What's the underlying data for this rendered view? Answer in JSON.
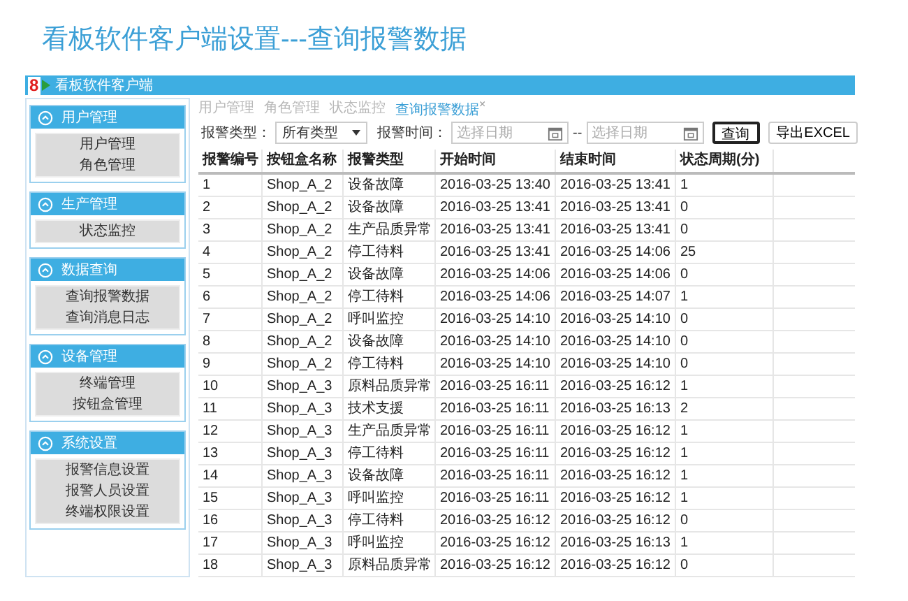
{
  "page_title": "看板软件客户端设置---查询报警数据",
  "window": {
    "title": "看板软件客户端",
    "logo_text": "8"
  },
  "sidebar": {
    "groups": [
      {
        "label": "用户管理",
        "expanded": true,
        "items": [
          "用户管理",
          "角色管理"
        ]
      },
      {
        "label": "生产管理",
        "expanded": true,
        "items": [
          "状态监控"
        ]
      },
      {
        "label": "数据查询",
        "expanded": true,
        "items": [
          "查询报警数据",
          "查询消息日志"
        ]
      },
      {
        "label": "设备管理",
        "expanded": true,
        "items": [
          "终端管理",
          "按钮盒管理"
        ]
      },
      {
        "label": "系统设置",
        "expanded": true,
        "items": [
          "报警信息设置",
          "报警人员设置",
          "终端权限设置"
        ]
      }
    ]
  },
  "tabs": [
    {
      "label": "用户管理",
      "selected": false
    },
    {
      "label": "角色管理",
      "selected": false
    },
    {
      "label": "状态监控",
      "selected": false
    },
    {
      "label": "查询报警数据",
      "selected": true,
      "close": "×"
    }
  ],
  "filters": {
    "type_label": "报警类型：",
    "type_value": "所有类型",
    "time_label": "报警时间：",
    "start": {
      "placeholder": "选择日期"
    },
    "separator": "--",
    "end": {
      "placeholder": "选择日期"
    },
    "buttons": [
      {
        "label": "查询",
        "focused": true
      },
      {
        "label": "导出EXCEL",
        "focused": false
      }
    ]
  },
  "table": {
    "columns": [
      "报警编号",
      "按钮盒名称",
      "报警类型",
      "开始时间",
      "结束时间",
      "状态周期(分)"
    ],
    "rows": [
      [
        "1",
        "Shop_A_2",
        "设备故障",
        "2016-03-25 13:40",
        "2016-03-25 13:41",
        "1"
      ],
      [
        "2",
        "Shop_A_2",
        "设备故障",
        "2016-03-25 13:41",
        "2016-03-25 13:41",
        "0"
      ],
      [
        "3",
        "Shop_A_2",
        "生产品质异常",
        "2016-03-25 13:41",
        "2016-03-25 13:41",
        "0"
      ],
      [
        "4",
        "Shop_A_2",
        "停工待料",
        "2016-03-25 13:41",
        "2016-03-25 14:06",
        "25"
      ],
      [
        "5",
        "Shop_A_2",
        "设备故障",
        "2016-03-25 14:06",
        "2016-03-25 14:06",
        "0"
      ],
      [
        "6",
        "Shop_A_2",
        "停工待料",
        "2016-03-25 14:06",
        "2016-03-25 14:07",
        "1"
      ],
      [
        "7",
        "Shop_A_2",
        "呼叫监控",
        "2016-03-25 14:10",
        "2016-03-25 14:10",
        "0"
      ],
      [
        "8",
        "Shop_A_2",
        "设备故障",
        "2016-03-25 14:10",
        "2016-03-25 14:10",
        "0"
      ],
      [
        "9",
        "Shop_A_2",
        "停工待料",
        "2016-03-25 14:10",
        "2016-03-25 14:10",
        "0"
      ],
      [
        "10",
        "Shop_A_3",
        "原料品质异常",
        "2016-03-25 16:11",
        "2016-03-25 16:12",
        "1"
      ],
      [
        "11",
        "Shop_A_3",
        "技术支援",
        "2016-03-25 16:11",
        "2016-03-25 16:13",
        "2"
      ],
      [
        "12",
        "Shop_A_3",
        "生产品质异常",
        "2016-03-25 16:11",
        "2016-03-25 16:12",
        "1"
      ],
      [
        "13",
        "Shop_A_3",
        "停工待料",
        "2016-03-25 16:11",
        "2016-03-25 16:12",
        "1"
      ],
      [
        "14",
        "Shop_A_3",
        "设备故障",
        "2016-03-25 16:11",
        "2016-03-25 16:12",
        "1"
      ],
      [
        "15",
        "Shop_A_3",
        "呼叫监控",
        "2016-03-25 16:11",
        "2016-03-25 16:12",
        "1"
      ],
      [
        "16",
        "Shop_A_3",
        "停工待料",
        "2016-03-25 16:12",
        "2016-03-25 16:12",
        "0"
      ],
      [
        "17",
        "Shop_A_3",
        "呼叫监控",
        "2016-03-25 16:12",
        "2016-03-25 16:13",
        "1"
      ],
      [
        "18",
        "Shop_A_3",
        "原料品质异常",
        "2016-03-25 16:12",
        "2016-03-25 16:12",
        "0"
      ]
    ]
  }
}
